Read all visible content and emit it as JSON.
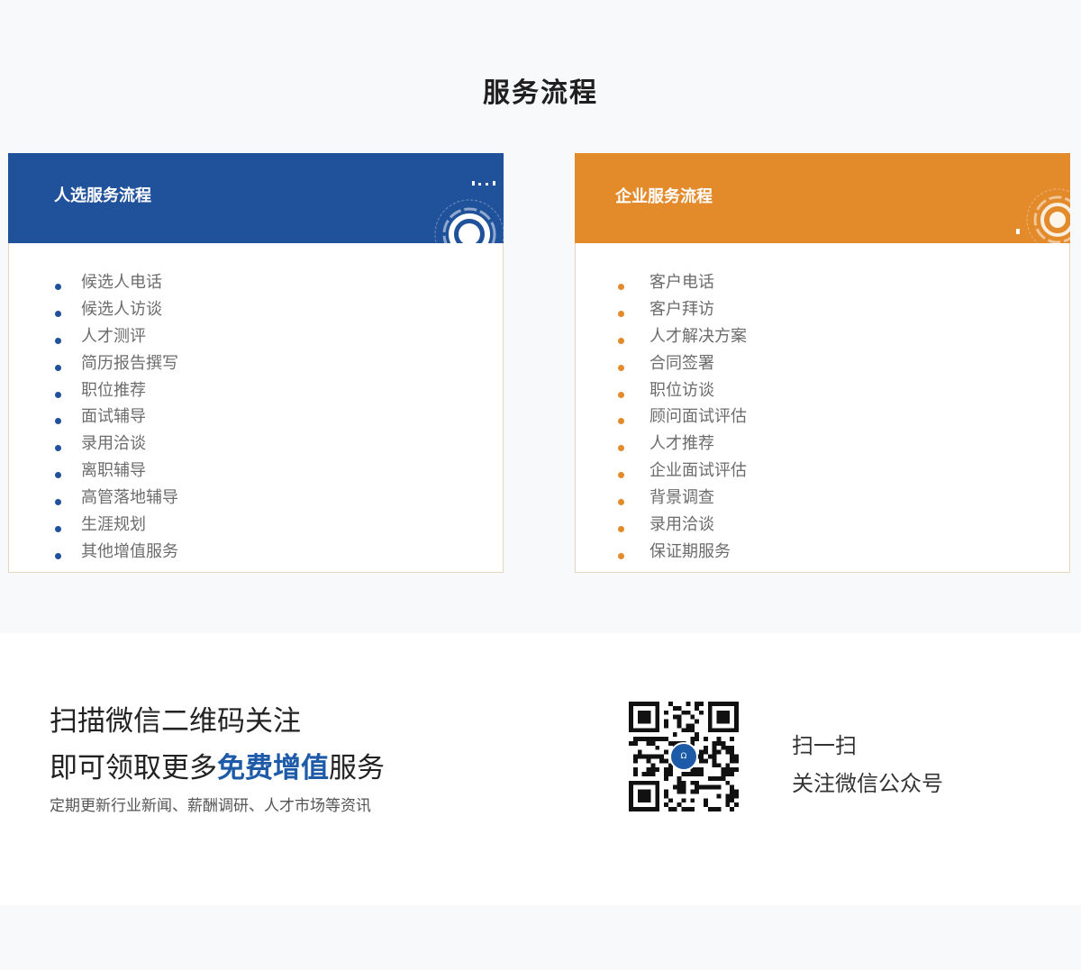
{
  "section_title": "服务流程",
  "candidate_card": {
    "title": "人选服务流程",
    "items": [
      "候选人电话",
      "候选人访谈",
      "人才测评",
      "简历报告撰写",
      "职位推荐",
      "面试辅导",
      "录用洽谈",
      "离职辅导",
      "高管落地辅导",
      "生涯规划",
      "其他增值服务"
    ]
  },
  "enterprise_card": {
    "title": "企业服务流程",
    "items": [
      "客户电话",
      "客户拜访",
      "人才解决方案",
      "合同签署",
      "职位访谈",
      "顾问面试评估",
      "人才推荐",
      "企业面试评估",
      "背景调查",
      "录用洽谈",
      "保证期服务"
    ]
  },
  "promo": {
    "line1": "扫描微信二维码关注",
    "line2_prefix": "即可领取更多",
    "line2_highlight": "免费增值",
    "line2_suffix": "服务",
    "sub": "定期更新行业新闻、薪酬调研、人才市场等资讯"
  },
  "qr": {
    "icon": "wechat-qr-code"
  },
  "scan": {
    "line1": "扫一扫",
    "line2": "关注微信公众号"
  },
  "colors": {
    "blue": "#20519b",
    "orange": "#e38a2b",
    "highlight": "#1d5aa7"
  }
}
